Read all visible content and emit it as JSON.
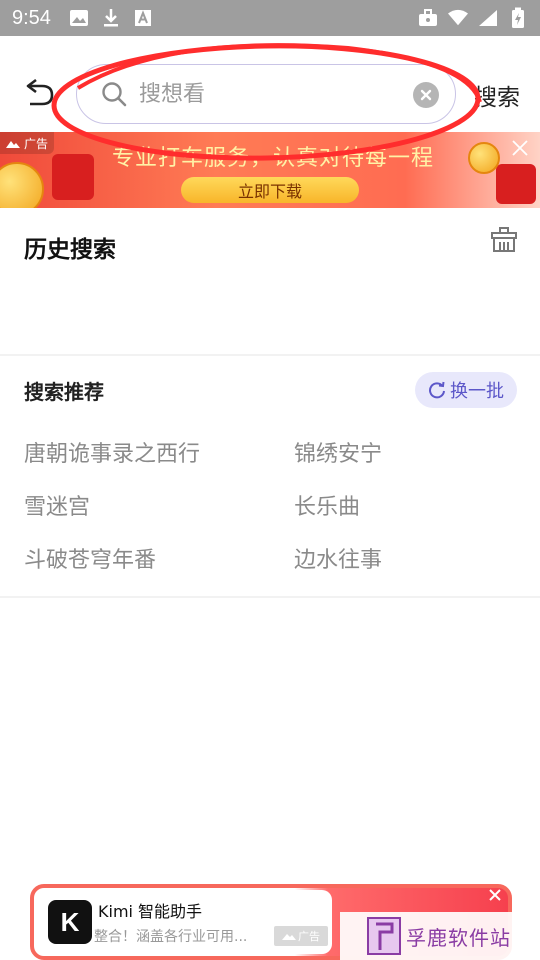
{
  "status_bar": {
    "time": "9:54"
  },
  "search": {
    "placeholder": "搜想看",
    "submit_label": "搜索"
  },
  "banner_ad": {
    "tag": "广告",
    "title": "专业打车服务，认真对待每一程",
    "download_label": "立即下载"
  },
  "history": {
    "title": "历史搜索"
  },
  "recommendations": {
    "title": "搜索推荐",
    "refresh_label": "换一批",
    "items": [
      "唐朝诡事录之西行",
      "锦绣安宁",
      "雪迷宫",
      "长乐曲",
      "斗破苍穹年番",
      "边水往事"
    ]
  },
  "bottom_ad": {
    "app_name": "Kimi 智能助手",
    "description": "整合！涵盖各行业可用...",
    "tag": "广告"
  },
  "watermark": {
    "text": "孚鹿软件站"
  },
  "colors": {
    "accent": "#5c57c9",
    "annotation_red": "#ff2d2d"
  }
}
